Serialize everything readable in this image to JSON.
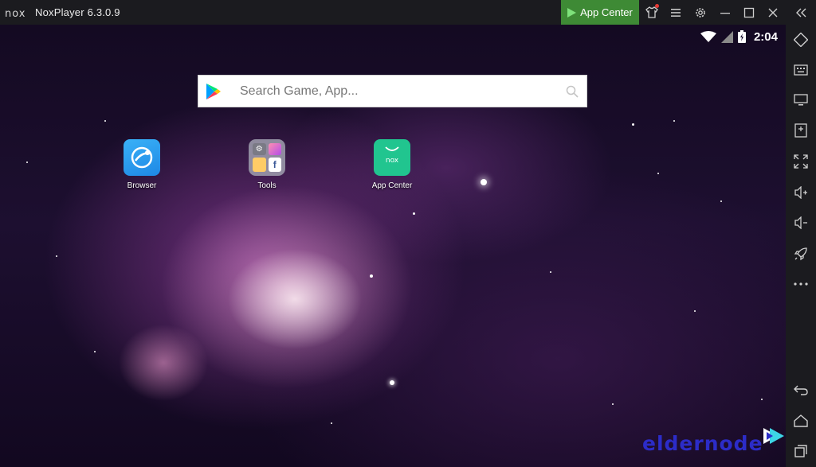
{
  "window": {
    "title": "NoxPlayer 6.3.0.9",
    "logo_text": "nox"
  },
  "toolbar": {
    "app_center_label": "App Center"
  },
  "statusbar": {
    "time": "2:04"
  },
  "search": {
    "placeholder": "Search Game, App..."
  },
  "apps": [
    {
      "label": "Browser"
    },
    {
      "label": "Tools"
    },
    {
      "label": "App Center",
      "icon_text": "nox"
    }
  ],
  "watermark": {
    "text": "eldernode"
  },
  "colors": {
    "titlebar": "#1b1b1f",
    "app_center_green": "#3e8a35",
    "app_center_icon": "#21c58f",
    "browser_blue": "#2196f3"
  },
  "sidebar_icons": [
    "rotate-icon",
    "keyboard-icon",
    "screen-icon",
    "add-apk-icon",
    "fullscreen-icon",
    "volume-up-icon",
    "volume-down-icon",
    "rocket-icon",
    "more-icon",
    "back-icon",
    "home-icon",
    "recent-apps-icon"
  ]
}
